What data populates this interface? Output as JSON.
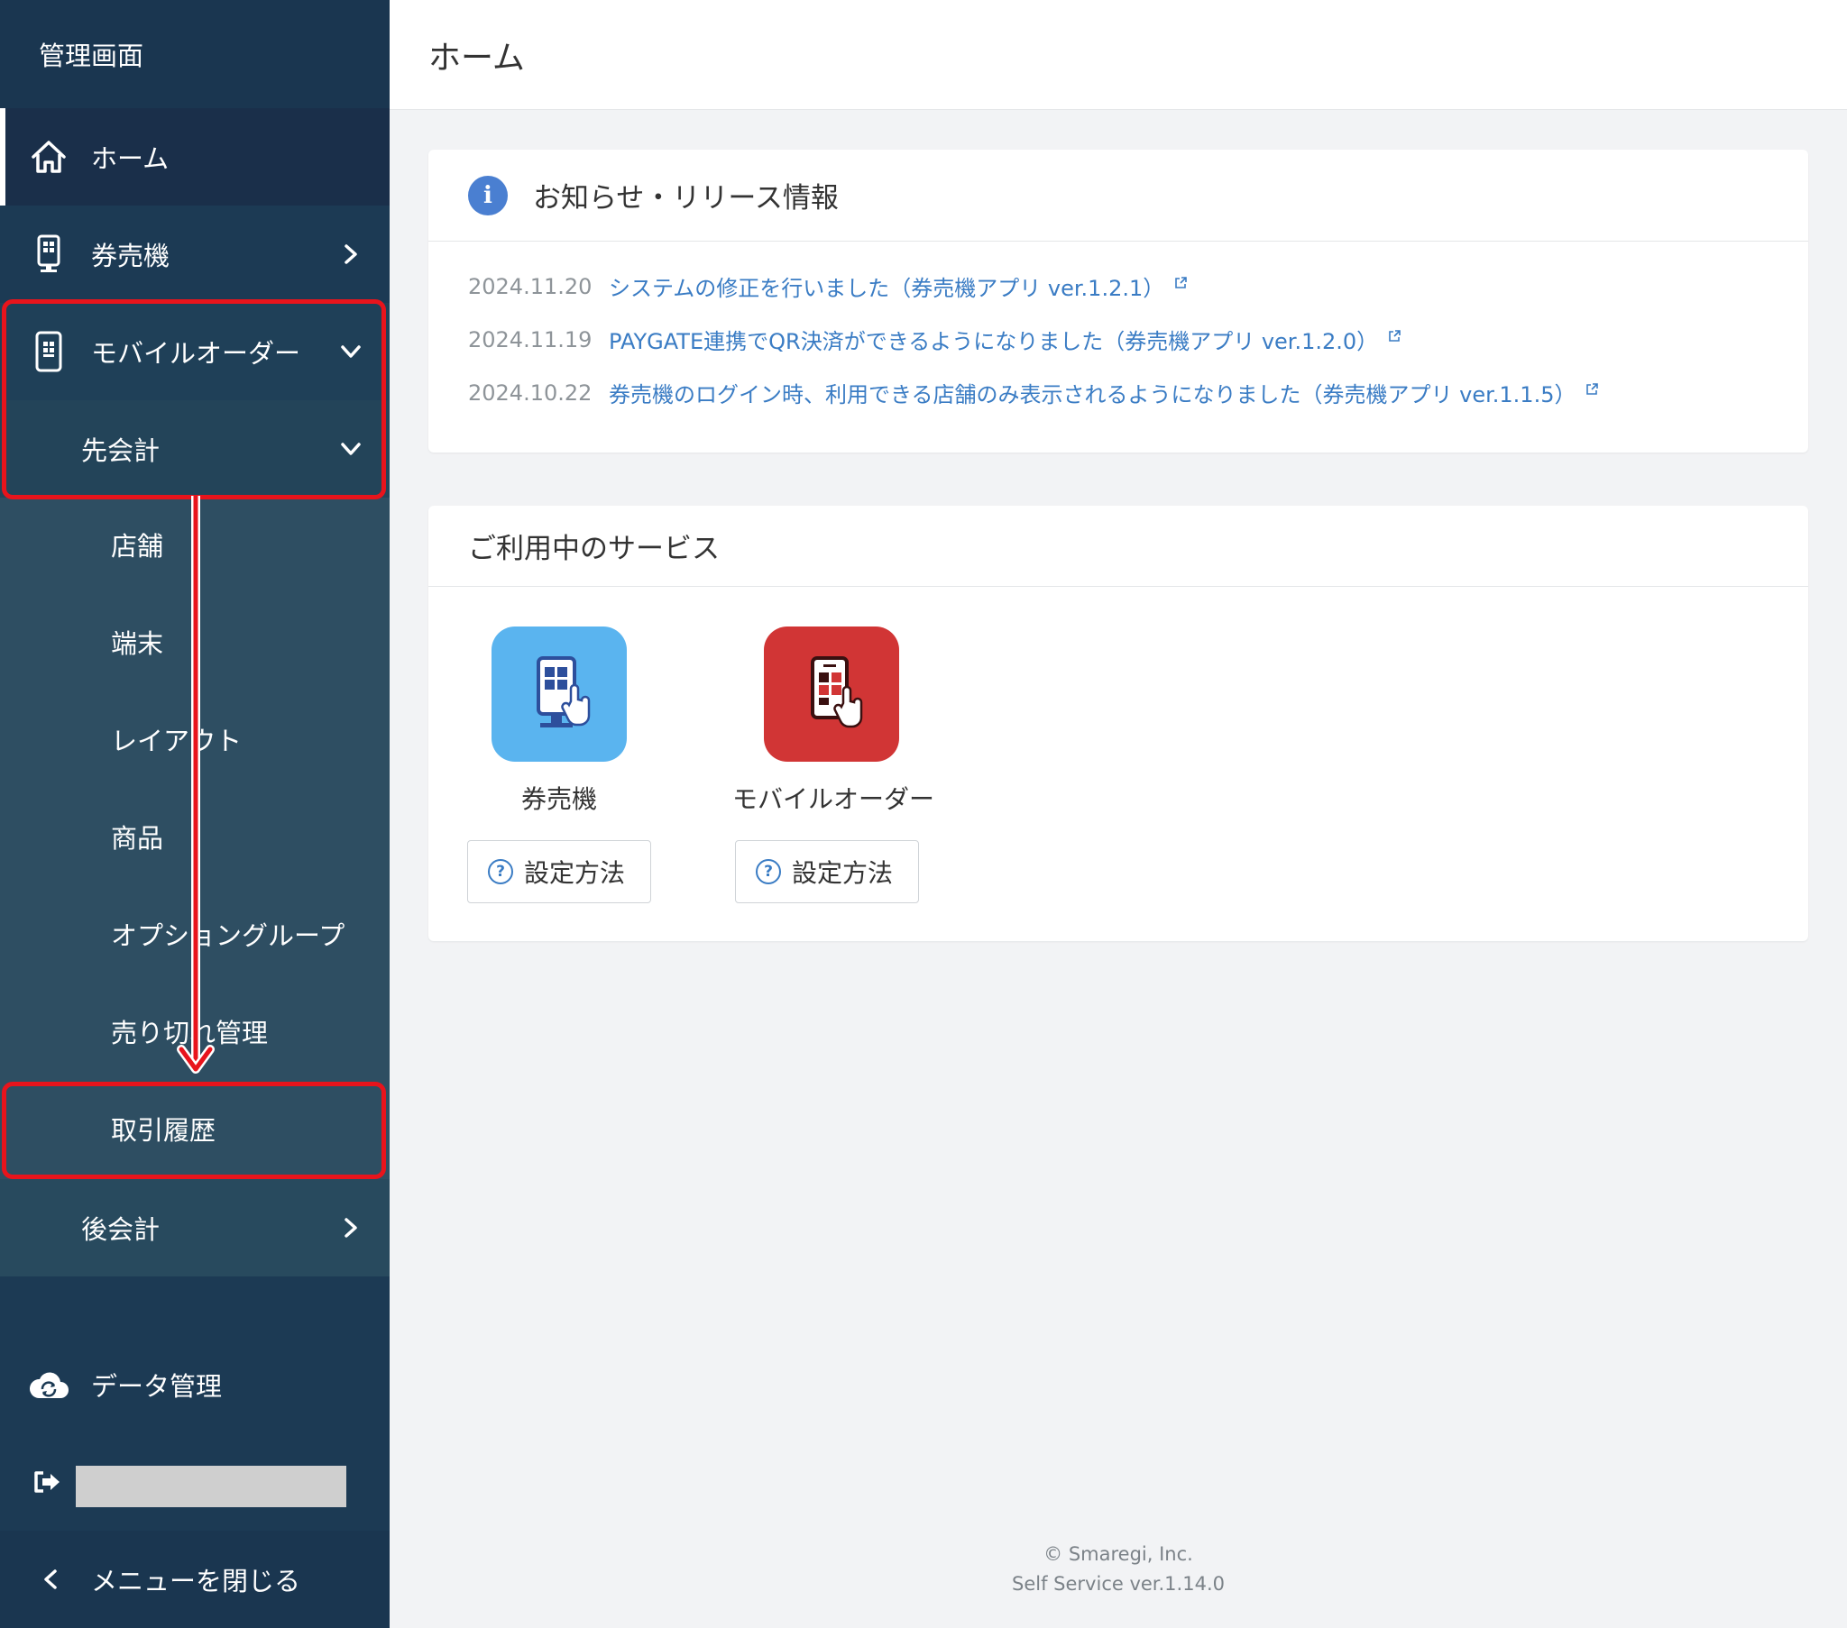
{
  "sidebar": {
    "title": "管理画面",
    "home_label": "ホーム",
    "ticket_label": "券売機",
    "mobile_label": "モバイルオーダー",
    "sakikaikei_label": "先会計",
    "sub_items": [
      "店舗",
      "端末",
      "レイアウト",
      "商品",
      "オプショングループ",
      "売り切れ管理",
      "取引履歴"
    ],
    "atokaikei_label": "後会計",
    "data_label": "データ管理",
    "close_label": "メニューを閉じる"
  },
  "header": {
    "title": "ホーム"
  },
  "news": {
    "title": "お知らせ・リリース情報",
    "items": [
      {
        "date": "2024.11.20",
        "text": "システムの修正を行いました（券売機アプリ ver.1.2.1）"
      },
      {
        "date": "2024.11.19",
        "text": "PAYGATE連携でQR決済ができるようになりました（券売機アプリ ver.1.2.0）"
      },
      {
        "date": "2024.10.22",
        "text": "券売機のログイン時、利用できる店舗のみ表示されるようになりました（券売機アプリ ver.1.1.5）"
      }
    ]
  },
  "services": {
    "title": "ご利用中のサービス",
    "items": [
      {
        "name": "券売機",
        "button": "設定方法",
        "color": "#5ab4ef",
        "icon": "kiosk-icon"
      },
      {
        "name": "モバイルオーダー",
        "button": "設定方法",
        "color": "#d13535",
        "icon": "mobile-order-icon"
      }
    ]
  },
  "footer": {
    "copyright": "© Smaregi, Inc.",
    "version": "Self Service ver.1.14.0"
  },
  "colors": {
    "sidebar": "#1c3a54",
    "link": "#3a7cc4",
    "highlight": "#e8141c"
  }
}
